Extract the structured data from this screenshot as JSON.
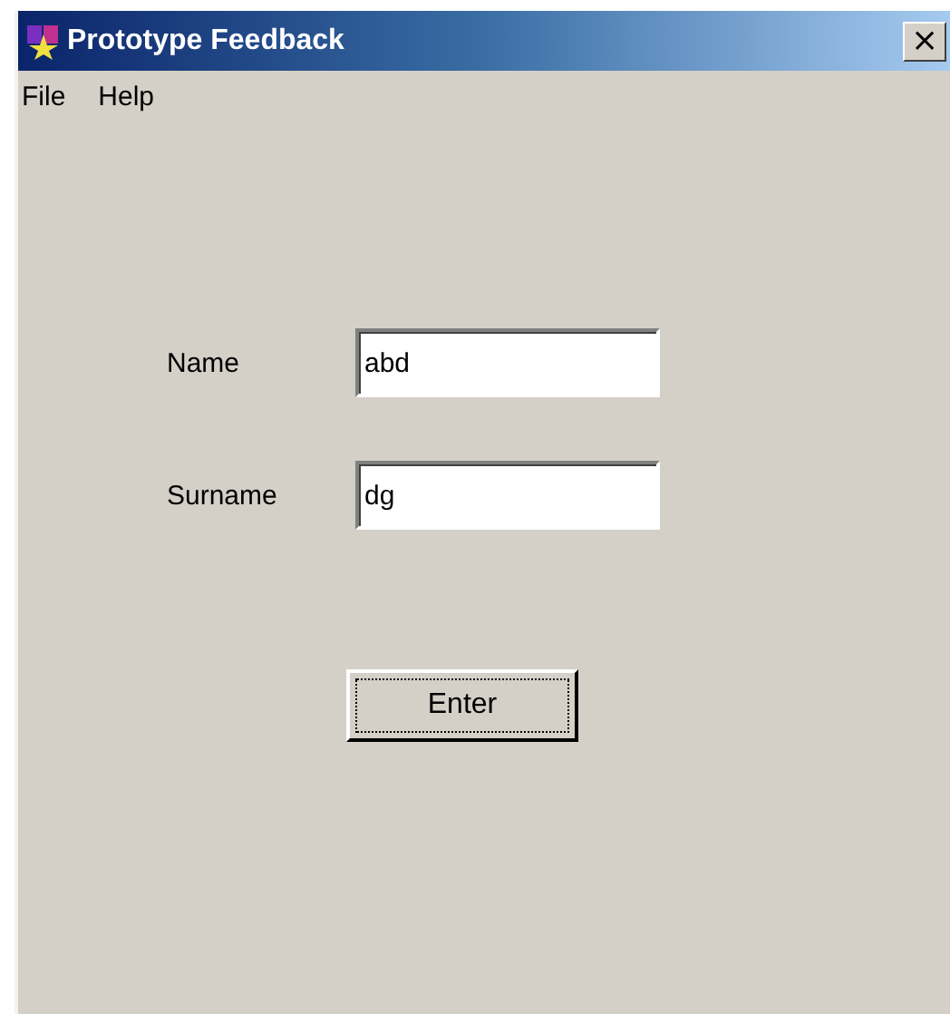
{
  "window": {
    "title": "Prototype Feedback",
    "close": "×"
  },
  "menu": [
    "File",
    "Help"
  ],
  "fields": [
    {
      "label": "Name",
      "value": "abd"
    },
    {
      "label": "Surname",
      "value": "dg"
    }
  ],
  "button": {
    "label": "Enter"
  }
}
